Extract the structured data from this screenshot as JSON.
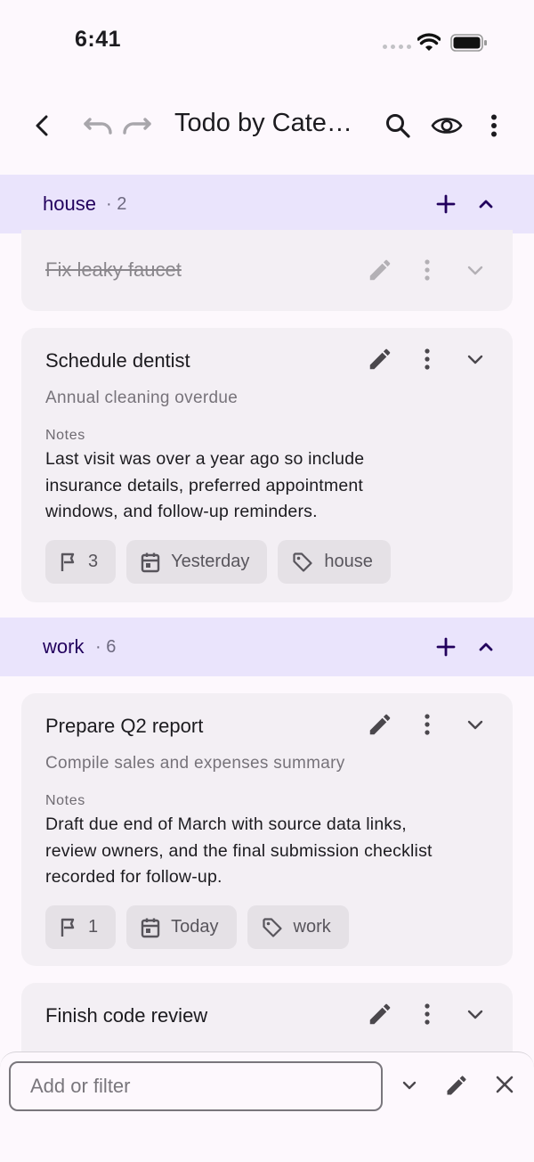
{
  "status_bar": {
    "time": "6:41"
  },
  "app_bar": {
    "title": "Todo by Categ..."
  },
  "groups": [
    {
      "name": "house",
      "count": "· 2",
      "items": [
        {
          "title": "Fix leaky faucet",
          "completed": true
        },
        {
          "title": "Schedule dentist",
          "completed": false,
          "subtitle": "Annual cleaning overdue",
          "notes_label": "Notes",
          "notes_lines": [
            "Last visit was over a year ago so include",
            "insurance details, preferred appointment",
            "windows, and follow-up reminders."
          ],
          "chips": {
            "priority": "3",
            "due": "Yesterday",
            "tag": "house"
          }
        }
      ]
    },
    {
      "name": "work",
      "count": "· 6",
      "items": [
        {
          "title": "Prepare Q2 report",
          "completed": false,
          "subtitle": "Compile sales and expenses summary",
          "notes_label": "Notes",
          "notes_lines": [
            "Draft due end of March with source data links,",
            "review owners, and the final submission checklist",
            "recorded for follow-up."
          ],
          "chips": {
            "priority": "1",
            "due": "Today",
            "tag": "work"
          }
        },
        {
          "title": "Finish code review",
          "completed": false
        }
      ]
    }
  ],
  "bottom_bar": {
    "placeholder": "Add or filter"
  },
  "colors": {
    "background": "#fdf8fd",
    "group_header_bg": "#eae4fc",
    "group_name": "#22005d",
    "card_bg": "#f3eff4",
    "chip_bg": "#e5e1e6"
  }
}
